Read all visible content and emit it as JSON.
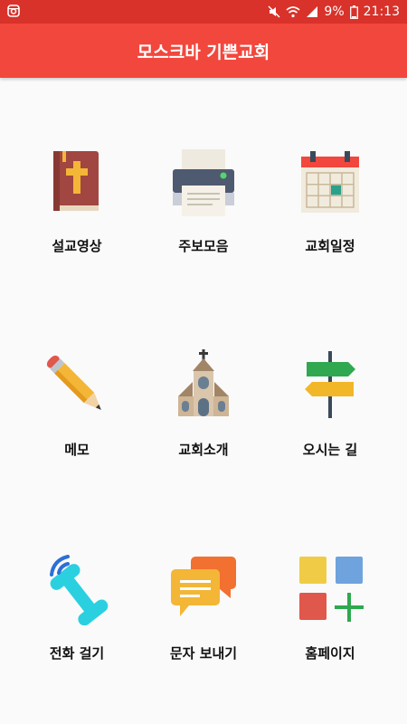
{
  "status_bar": {
    "left_icon": "instagram-icon",
    "signal_icons": [
      "mute-icon",
      "wifi-icon",
      "cell-signal-icon"
    ],
    "battery": "9%",
    "time": "21:13"
  },
  "app_bar": {
    "title": "모스크바 기쁜교회"
  },
  "menu": {
    "items": [
      {
        "label": "설교영상",
        "icon": "bible-icon"
      },
      {
        "label": "주보모음",
        "icon": "printer-icon"
      },
      {
        "label": "교회일정",
        "icon": "calendar-icon"
      },
      {
        "label": "메모",
        "icon": "pencil-icon"
      },
      {
        "label": "교회소개",
        "icon": "church-icon"
      },
      {
        "label": "오시는 길",
        "icon": "signpost-icon"
      },
      {
        "label": "전화 걸기",
        "icon": "phone-icon"
      },
      {
        "label": "문자 보내기",
        "icon": "chat-icon"
      },
      {
        "label": "홈페이지",
        "icon": "apps-icon"
      }
    ]
  },
  "colors": {
    "status_bar": "#d8322a",
    "app_bar": "#f2473d",
    "background": "#fafafa"
  }
}
